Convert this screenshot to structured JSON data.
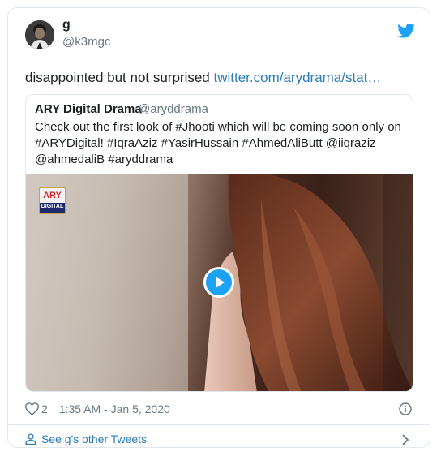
{
  "tweet": {
    "author_name": "g",
    "author_handle": "@k3mgc",
    "text": "disappointed but not surprised ",
    "link_text": "twitter.com/arydrama/stat…",
    "likes": "2",
    "timestamp": "1:35 AM - Jan 5, 2020"
  },
  "quoted": {
    "name": "ARY Digital Drama",
    "handle": "@aryddrama",
    "text": "Check out the first look of #Jhooti which will be coming soon only on #ARYDigital! #IqraAziz #YasirHussain #AhmedAliButt @iiqraziz @ahmedaliB #aryddrama",
    "logo_top": "ARY",
    "logo_bottom": "DIGITAL"
  },
  "footer": {
    "label": "See g's other Tweets"
  },
  "icons": {
    "brand": "twitter-bird-icon",
    "like": "heart-icon",
    "info": "info-icon",
    "profile": "person-icon",
    "next": "chevron-right-icon",
    "play": "play-icon"
  },
  "colors": {
    "link": "#2b7bb9",
    "brand": "#1da1f2",
    "muted": "#697882",
    "border": "#e1e8ed"
  }
}
